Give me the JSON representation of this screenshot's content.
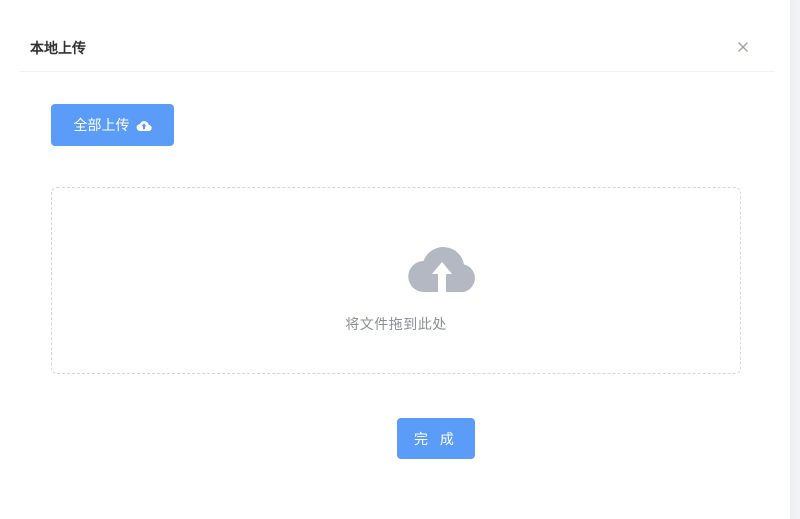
{
  "dialog": {
    "title": "本地上传",
    "close_icon": "close-icon"
  },
  "toolbar": {
    "upload_all_label": "全部上传",
    "upload_all_icon": "cloud-upload-icon"
  },
  "dropzone": {
    "icon": "cloud-upload-icon",
    "hint": "将文件拖到此处"
  },
  "footer": {
    "done_label": "完 成"
  },
  "colors": {
    "primary": "#5b9cf8",
    "icon_gray": "#b4b8c2",
    "text_muted": "#8a8f99",
    "title": "#303133"
  }
}
